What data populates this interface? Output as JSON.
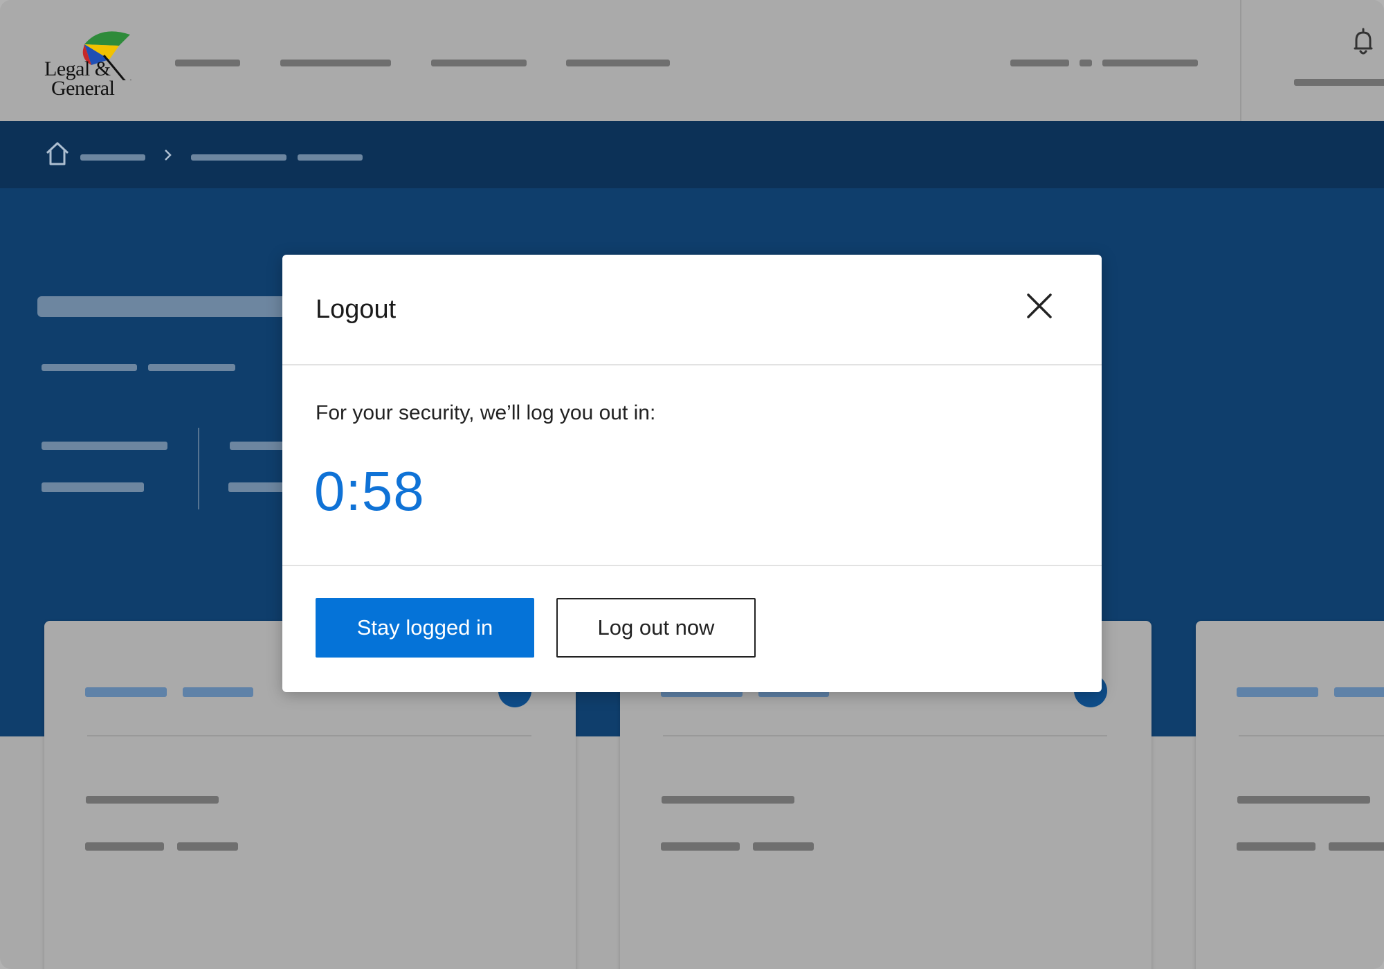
{
  "brand": {
    "name_line1": "Legal &",
    "name_line2": "General"
  },
  "icons": {
    "logo": "umbrella-logo-icon",
    "notifications": "bell-icon",
    "home": "home-icon",
    "breadcrumb_separator": "chevron-right-icon",
    "close": "close-icon",
    "card_arrow": "arrow-right-icon"
  },
  "modal": {
    "title": "Logout",
    "message": "For your security, we’ll log you out in:",
    "countdown": "0:58",
    "primary_button": "Stay logged in",
    "secondary_button": "Log out now"
  },
  "colors": {
    "primary": "#0573d8",
    "countdown": "#0f72d6",
    "hero": "#0f3e6c",
    "breadcrumb_band": "#0c3157",
    "overlay_gray": "#aaaaaa"
  }
}
